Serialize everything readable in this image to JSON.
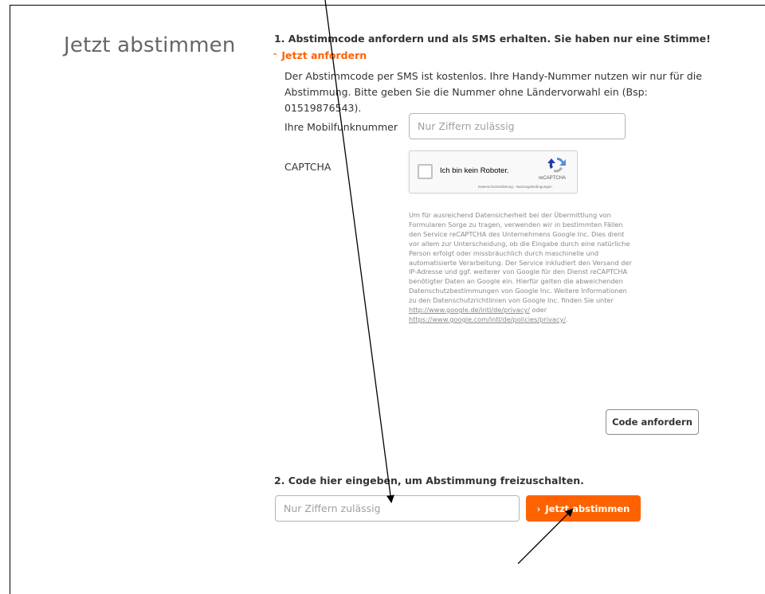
{
  "page": {
    "title": "Jetzt abstimmen"
  },
  "step1": {
    "heading": "1. Abstimmcode anfordern und als SMS erhalten. Sie haben nur eine Stimme!",
    "toggle_icon": "chevron-up-icon",
    "toggle_label": "Jetzt anfordern",
    "info": "Der Abstimmcode per SMS ist kostenlos. Ihre Handy-Nummer nutzen wir nur für die Abstimmung. Bitte geben Sie die Nummer ohne Ländervorwahl ein (Bsp: 01519876543).",
    "mobile_label": "Ihre Mobilfunknummer",
    "mobile_placeholder": "Nur Ziffern zulässig",
    "mobile_value": "",
    "captcha_label": "CAPTCHA",
    "recaptcha": {
      "checkbox_label": "Ich bin kein Roboter.",
      "brand": "reCAPTCHA",
      "terms": "Datenschutzerklärung - Nutzungsbedingungen",
      "logo_icon": "recaptcha-logo-icon",
      "checked": false
    },
    "captcha_info": "Um für ausreichend Datensicherheit bei der Übermittlung von Formularen Sorge zu tragen, verwenden wir in bestimmten Fällen den Service reCAPTCHA des Unternehmens Google Inc. Dies dient vor allem zur Unterscheidung, ob die Eingabe durch eine natürliche Person erfolgt oder missbräuchlich durch maschinelle und automatisierte Verarbeitung. Der Service inkludiert den Versand der IP-Adresse und ggf. weiterer von Google für den Dienst reCAPTCHA benötigter Daten an Google ein. Hierfür gelten die abweichenden Datenschutzbestimmungen von Google Inc. Weitere Informationen zu den Datenschutzrichtlinien von Google Inc. finden Sie unter",
    "privacy_link_1": "http://www.google.de/intl/de/privacy/",
    "link_separator": "oder",
    "privacy_link_2": "https://www.google.com/intl/de/policies/privacy/",
    "privacy_link_2_suffix": ".",
    "request_button": "Code anfordern"
  },
  "step2": {
    "heading": "2. Code hier eingeben, um Abstimmung freizuschalten.",
    "code_placeholder": "Nur Ziffern zulässig",
    "code_value": "",
    "vote_icon": "chevron-right-icon",
    "vote_button": "Jetzt abstimmen"
  },
  "colors": {
    "accent": "#ff6200",
    "text": "#333333",
    "muted": "#8a8a8a",
    "title": "#666666"
  },
  "annotations": {
    "arrow_icon": "pointer-arrow-icon"
  }
}
